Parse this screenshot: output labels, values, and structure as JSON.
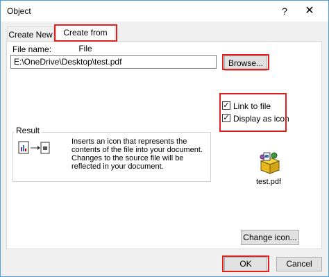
{
  "window": {
    "title": "Object",
    "help_glyph": "?",
    "close_glyph": "✕"
  },
  "tabs": [
    {
      "label": "Create New",
      "active": false
    },
    {
      "label": "Create from File",
      "active": true
    }
  ],
  "file_name": {
    "label": "File name:",
    "value": "E:\\OneDrive\\Desktop\\test.pdf"
  },
  "buttons": {
    "browse": "Browse...",
    "change_icon": "Change icon...",
    "ok": "OK",
    "cancel": "Cancel"
  },
  "options": {
    "link_to_file": {
      "label": "Link to file",
      "checked": true
    },
    "display_as_icon": {
      "label": "Display as icon",
      "checked": true
    }
  },
  "result": {
    "title": "Result",
    "text": "Inserts an icon that represents the contents of the file into your document. Changes to the source file will be reflected in your document."
  },
  "icon_preview": {
    "label": "test.pdf",
    "icon": "package-icon"
  },
  "colors": {
    "highlight": "#e0201c",
    "border_accent": "#4b9fe0"
  }
}
